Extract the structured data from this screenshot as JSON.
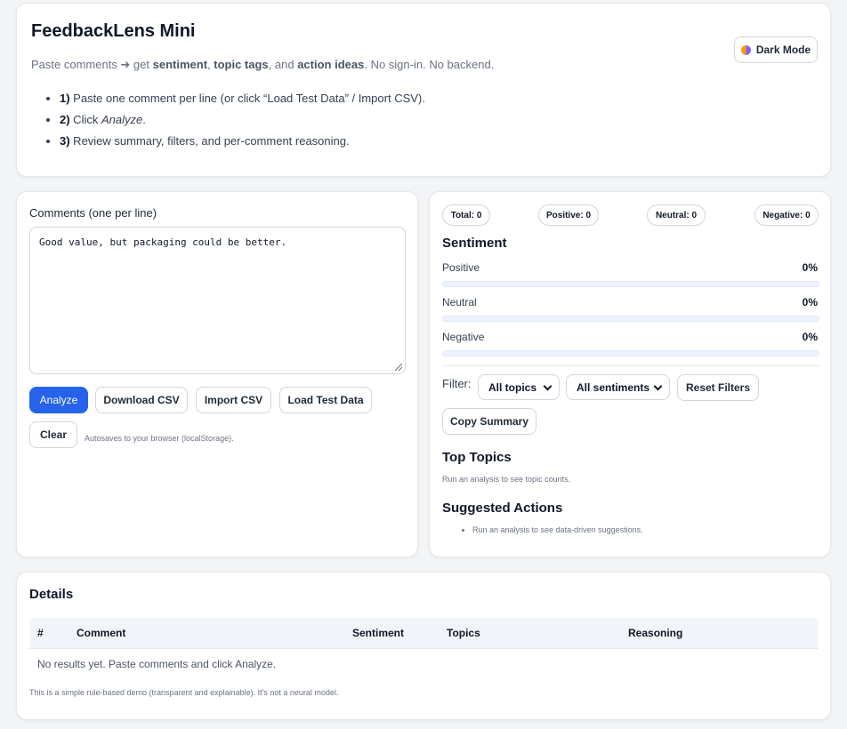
{
  "header": {
    "title": "FeedbackLens Mini",
    "subtitle_prefix": "Paste comments ➜ get ",
    "subtitle_sentiment": "sentiment",
    "subtitle_comma": ", ",
    "subtitle_topics": "topic tags",
    "subtitle_and": ", and ",
    "subtitle_actions": "action ideas",
    "subtitle_suffix": ". No sign-in. No backend.",
    "dark_mode_label": "Dark Mode",
    "steps": [
      {
        "num": "1)",
        "text": " Paste one comment per line (or click “Load Test Data” / Import CSV)."
      },
      {
        "num": "2)",
        "text_pre": " Click ",
        "text_em": "Analyze",
        "text_post": "."
      },
      {
        "num": "3)",
        "text": " Review summary, filters, and per-comment reasoning."
      }
    ]
  },
  "input": {
    "label": "Comments (one per line)",
    "value": "Good value, but packaging could be better.",
    "buttons": {
      "analyze": "Analyze",
      "download": "Download CSV",
      "import": "Import CSV",
      "load_test": "Load Test Data",
      "clear": "Clear"
    },
    "autosave_note": "Autosaves to your browser (localStorage)."
  },
  "results": {
    "counts": {
      "total": "Total: 0",
      "positive": "Positive: 0",
      "neutral": "Neutral: 0",
      "negative": "Negative: 0"
    },
    "sentiment_heading": "Sentiment",
    "meters": [
      {
        "label": "Positive",
        "pct_text": "0%",
        "fraction": 0
      },
      {
        "label": "Neutral",
        "pct_text": "0%",
        "fraction": 0
      },
      {
        "label": "Negative",
        "pct_text": "0%",
        "fraction": 0
      }
    ],
    "filter_label": "Filter:",
    "topic_select": "All topics",
    "sentiment_select": "All sentiments",
    "reset_label": "Reset Filters",
    "copy_label": "Copy Summary",
    "topics_heading": "Top Topics",
    "topics_hint": "Run an analysis to see topic counts.",
    "actions_heading": "Suggested Actions",
    "actions": [
      "Run an analysis to see data-driven suggestions."
    ]
  },
  "details": {
    "heading": "Details",
    "columns": [
      "#",
      "Comment",
      "Sentiment",
      "Topics",
      "Reasoning"
    ],
    "empty_message": "No results yet. Paste comments and click Analyze.",
    "footnote": "This is a simple rule-based demo (transparent and explainable). It's not a neural model."
  },
  "colors": {
    "accent": "#2563eb",
    "background": "#f3f4f6",
    "table_header": "#f1f4f9"
  }
}
